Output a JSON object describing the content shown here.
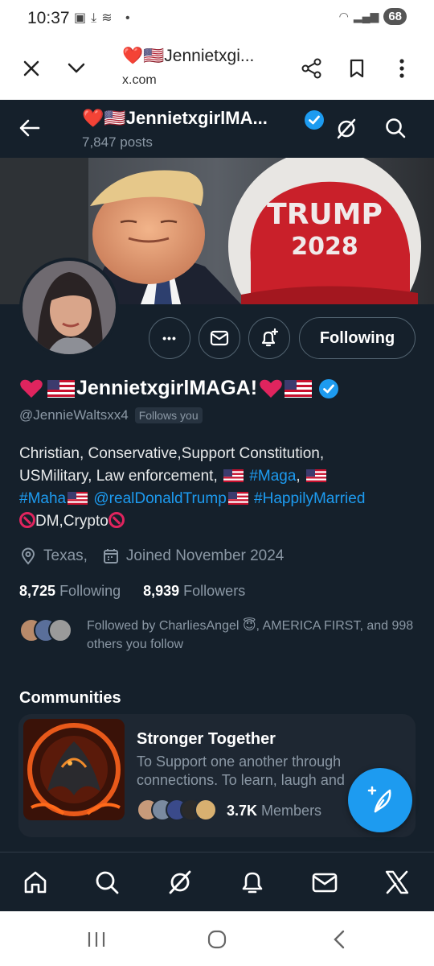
{
  "status_bar": {
    "time": "10:37",
    "battery": "68"
  },
  "browser": {
    "tab_title": "❤️🇺🇸Jennietxgi...",
    "domain": "x.com"
  },
  "header": {
    "name": "❤️🇺🇸JennietxgirlMA...",
    "posts": "7,847 posts"
  },
  "banner": {
    "hat_line1": "TRUMP",
    "hat_line2": "2028"
  },
  "actions": {
    "more_label": "•••",
    "following_label": "Following"
  },
  "profile": {
    "display_name": "JennietxgirlMAGA!",
    "handle": "@JennieWaltsxx4",
    "follows_you": "Follows you",
    "bio": {
      "line1": "Christian, Conservative,Support Constitution,",
      "line2_a": "USMilitary, Law enforcement,",
      "hashtag_maga": "#Maga",
      "line2_comma": ",",
      "hashtag_maha": "#Maha",
      "mention": "@realDonaldTrump",
      "hashtag_married": "#HappilyMarried",
      "dm_crypto": "DM,Crypto"
    },
    "location": "Texas,",
    "joined": "Joined November 2024",
    "following_count": "8,725",
    "following_label": "Following",
    "followers_count": "8,939",
    "followers_label": "Followers",
    "followed_by_text": "Followed by CharliesAngel 😇, AMERICA FIRST, and 998 others you follow"
  },
  "communities": {
    "title": "Communities",
    "items": [
      {
        "name": "Stronger Together",
        "description_line1": "To Support one another through",
        "description_line2": "connections. To learn, laugh and",
        "members_count": "3.7K",
        "members_label": "Members"
      }
    ]
  },
  "bottom_nav": [
    "home-icon",
    "search-icon",
    "grok-icon",
    "notifications-icon",
    "messages-icon",
    "x-logo-icon"
  ],
  "colors": {
    "background": "#15202b",
    "accent": "#1d9bf0",
    "muted": "#8b98a5",
    "heart": "#e0245e"
  }
}
